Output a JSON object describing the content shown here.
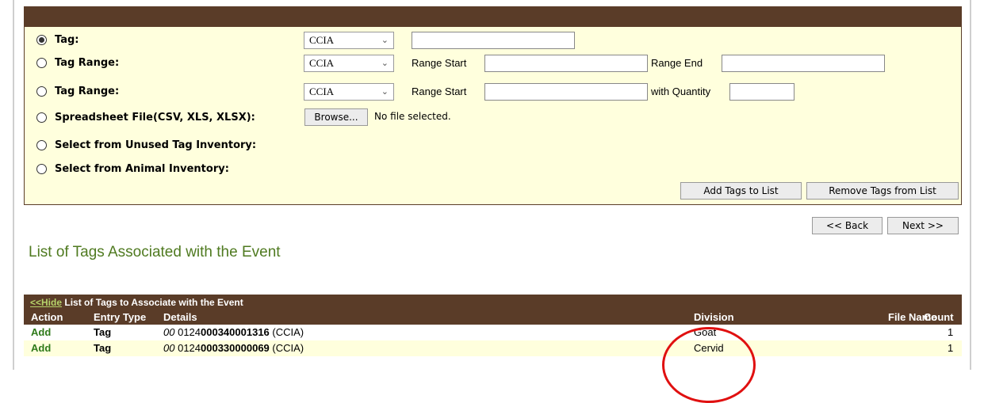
{
  "form": {
    "rows": [
      {
        "label": "Tag:",
        "checked": true,
        "select": "CCIA"
      },
      {
        "label": "Tag Range:",
        "checked": false,
        "select": "CCIA",
        "start_label": "Range Start",
        "end_label": "Range End"
      },
      {
        "label": "Tag Range:",
        "checked": false,
        "select": "CCIA",
        "start_label": "Range Start",
        "qty_label": "with Quantity"
      },
      {
        "label": "Spreadsheet File(CSV, XLS, XLSX):",
        "checked": false,
        "browse": "Browse...",
        "file_status": "No file selected."
      },
      {
        "label": "Select from Unused Tag Inventory:",
        "checked": false
      },
      {
        "label": "Select from Animal Inventory:",
        "checked": false
      }
    ],
    "add_button": "Add Tags to List",
    "remove_button": "Remove Tags from List"
  },
  "nav": {
    "back": "<< Back",
    "next": "Next >>"
  },
  "section_title": "List of Tags Associated with the Event",
  "table": {
    "hide_link": "<<Hide",
    "caption": " List of Tags to Associate with the Event",
    "headers": {
      "action": "Action",
      "entry_type": "Entry Type",
      "details": "Details",
      "division": "Division",
      "file_name": "File Name",
      "count": "Count"
    },
    "rows": [
      {
        "action": "Add",
        "entry_type": "Tag",
        "prefix": "00",
        "tag_pre": "0124",
        "tag_bold": "000340001316",
        "suffix": " (CCIA)",
        "division": "Goat",
        "count": "1"
      },
      {
        "action": "Add",
        "entry_type": "Tag",
        "prefix": "00",
        "tag_pre": "0124",
        "tag_bold": "000330000069",
        "suffix": " (CCIA)",
        "division": "Cervid",
        "count": "1"
      }
    ]
  },
  "colors": {
    "header_brown": "#5a3c28",
    "panel_yellow": "#ffffdd",
    "title_green": "#4f7a20",
    "annotation_red": "#e01010"
  }
}
